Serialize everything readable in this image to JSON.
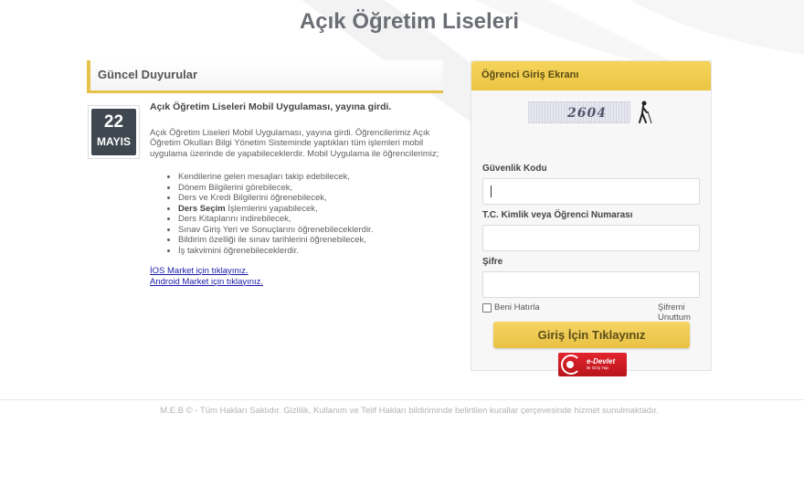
{
  "page": {
    "title": "Açık Öğretim Liseleri"
  },
  "news": {
    "header": "Güncel Duyurular",
    "item": {
      "day": "22",
      "month": "MAYIS",
      "title": "Açık Öğretim Liseleri Mobil Uygulaması, yayına girdi.",
      "text": "Açık Öğretim Liseleri Mobil Uygulaması, yayına girdi. Öğrencilerimiz Açık Öğretim Okulları Bilgi Yönetim Sisteminde yaptıkları tüm işlemleri mobil uygulama üzerinde de yapabileceklerdir. Mobil Uygulama ile öğrencilerimiz;",
      "list": [
        "Kendilerine gelen mesajları takip edebilecek,",
        "Dönem Bilgilerini görebilecek,",
        "Ders ve Kredi Bilgilerini öğrenebilecek,",
        "Ders Kitaplarını indirebilecek,",
        "Sınav Giriş Yeri ve Sonuçlarını öğrenebileceklerdir.",
        "Bildirim özelliği ile sınav tarihlerini öğrenebilecek,",
        "İş takvimini öğrenebileceklerdir."
      ],
      "ders_secim_bold": "Ders Seçim",
      "ders_secim_rest": " İşlemlerini yapabilecek,",
      "ios_link": "İOS Market için tıklayınız.",
      "android_link": "Android Market için tıklayınız."
    }
  },
  "login": {
    "header": "Öğrenci Giriş Ekranı",
    "captcha_text": "2604",
    "security_label": "Güvenlik Kodu",
    "security_value": "",
    "id_label": "T.C. Kimlik veya Öğrenci Numarası",
    "id_value": "",
    "password_label": "Şifre",
    "password_value": "",
    "remember_label": "Beni Hatırla",
    "forgot_label": "Şifremi Unuttum",
    "submit_label": "Giriş İçin Tıklayınız",
    "edevlet_main": "e-Devlet",
    "edevlet_sub": "ile Giriş Yap"
  },
  "footer": {
    "text": "M.E.B © - Tüm Hakları Saklıdır. Gizlilik, Kullanım ve Telif Hakları bildiriminde belirtilen kurallar çerçevesinde hizmet sunulmaktadır."
  },
  "colors": {
    "accent_gold": "#e7c24a",
    "date_box": "#3f4750",
    "edevlet_red": "#d01e26",
    "link_blue": "#1a1aa8"
  },
  "icons": {
    "audio": "accessibility-audio-icon",
    "edevlet": "edevlet-logo-icon"
  }
}
